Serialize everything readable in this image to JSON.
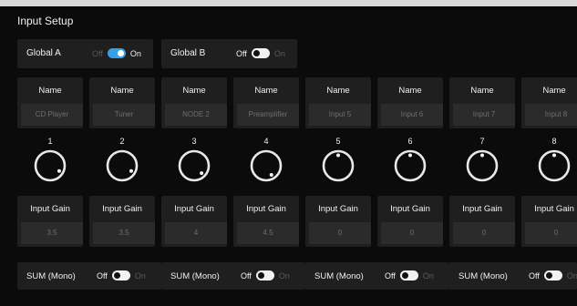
{
  "top_bar_color": "#d9d9d9",
  "accent_color": "#3aa0e6",
  "title": "Input Setup",
  "global": [
    {
      "label": "Global A",
      "off_label": "Off",
      "on_label": "On",
      "state": "on"
    },
    {
      "label": "Global B",
      "off_label": "Off",
      "on_label": "On",
      "state": "off"
    }
  ],
  "channels": [
    {
      "name_header": "Name",
      "name_value": "CD Player",
      "number": "1",
      "knob_angle": 120,
      "gain_header": "Input Gain",
      "gain_value": "3.5"
    },
    {
      "name_header": "Name",
      "name_value": "Tuner",
      "number": "2",
      "knob_angle": 120,
      "gain_header": "Input Gain",
      "gain_value": "3.5"
    },
    {
      "name_header": "Name",
      "name_value": "NODE 2",
      "number": "3",
      "knob_angle": 135,
      "gain_header": "Input Gain",
      "gain_value": "4"
    },
    {
      "name_header": "Name",
      "name_value": "Preamplifier",
      "number": "4",
      "knob_angle": 150,
      "gain_header": "Input Gain",
      "gain_value": "4.5"
    },
    {
      "name_header": "Name",
      "name_value": "Input 5",
      "number": "5",
      "knob_angle": 0,
      "gain_header": "Input Gain",
      "gain_value": "0"
    },
    {
      "name_header": "Name",
      "name_value": "Input 6",
      "number": "6",
      "knob_angle": 0,
      "gain_header": "Input Gain",
      "gain_value": "0"
    },
    {
      "name_header": "Name",
      "name_value": "Input 7",
      "number": "7",
      "knob_angle": 0,
      "gain_header": "Input Gain",
      "gain_value": "0"
    },
    {
      "name_header": "Name",
      "name_value": "Input 8",
      "number": "8",
      "knob_angle": 0,
      "gain_header": "Input Gain",
      "gain_value": "0"
    }
  ],
  "sum": [
    {
      "label": "SUM (Mono)",
      "off_label": "Off",
      "on_label": "On",
      "state": "off"
    },
    {
      "label": "SUM (Mono)",
      "off_label": "Off",
      "on_label": "On",
      "state": "off"
    },
    {
      "label": "SUM (Mono)",
      "off_label": "Off",
      "on_label": "On",
      "state": "off"
    },
    {
      "label": "SUM (Mono)",
      "off_label": "Off",
      "on_label": "On",
      "state": "off"
    }
  ]
}
